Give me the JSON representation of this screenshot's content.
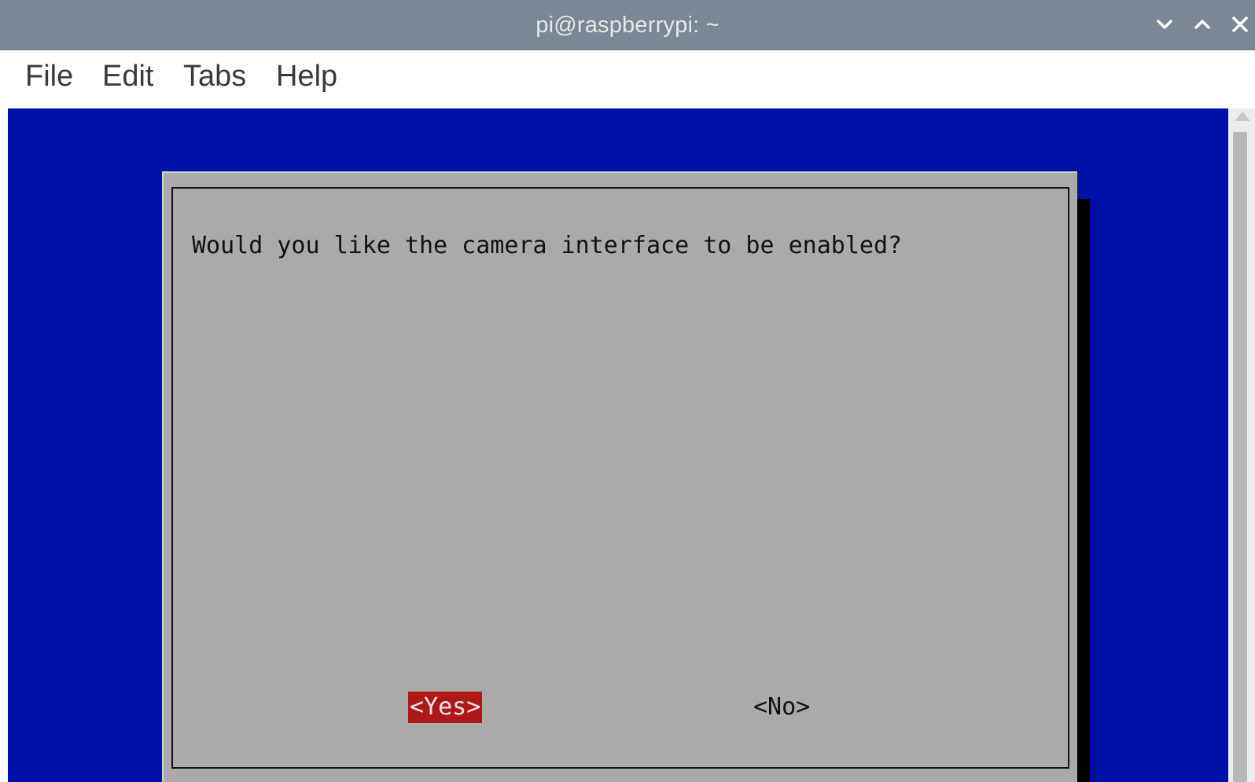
{
  "window": {
    "title": "pi@raspberrypi: ~",
    "controls": {
      "minimize_icon": "chevron-down-icon",
      "maximize_icon": "chevron-up-icon",
      "close_icon": "close-icon"
    }
  },
  "menubar": {
    "items": [
      {
        "label": "File"
      },
      {
        "label": "Edit"
      },
      {
        "label": "Tabs"
      },
      {
        "label": "Help"
      }
    ]
  },
  "dialog": {
    "question": "Would you like the camera interface to be enabled?",
    "yes_label": "<Yes>",
    "no_label": "<No>",
    "selected": "yes"
  },
  "colors": {
    "titlebar": "#7b8794",
    "terminal_background": "#0011a8",
    "dialog_background": "#aaaaaa",
    "selected_button": "#b01818"
  }
}
